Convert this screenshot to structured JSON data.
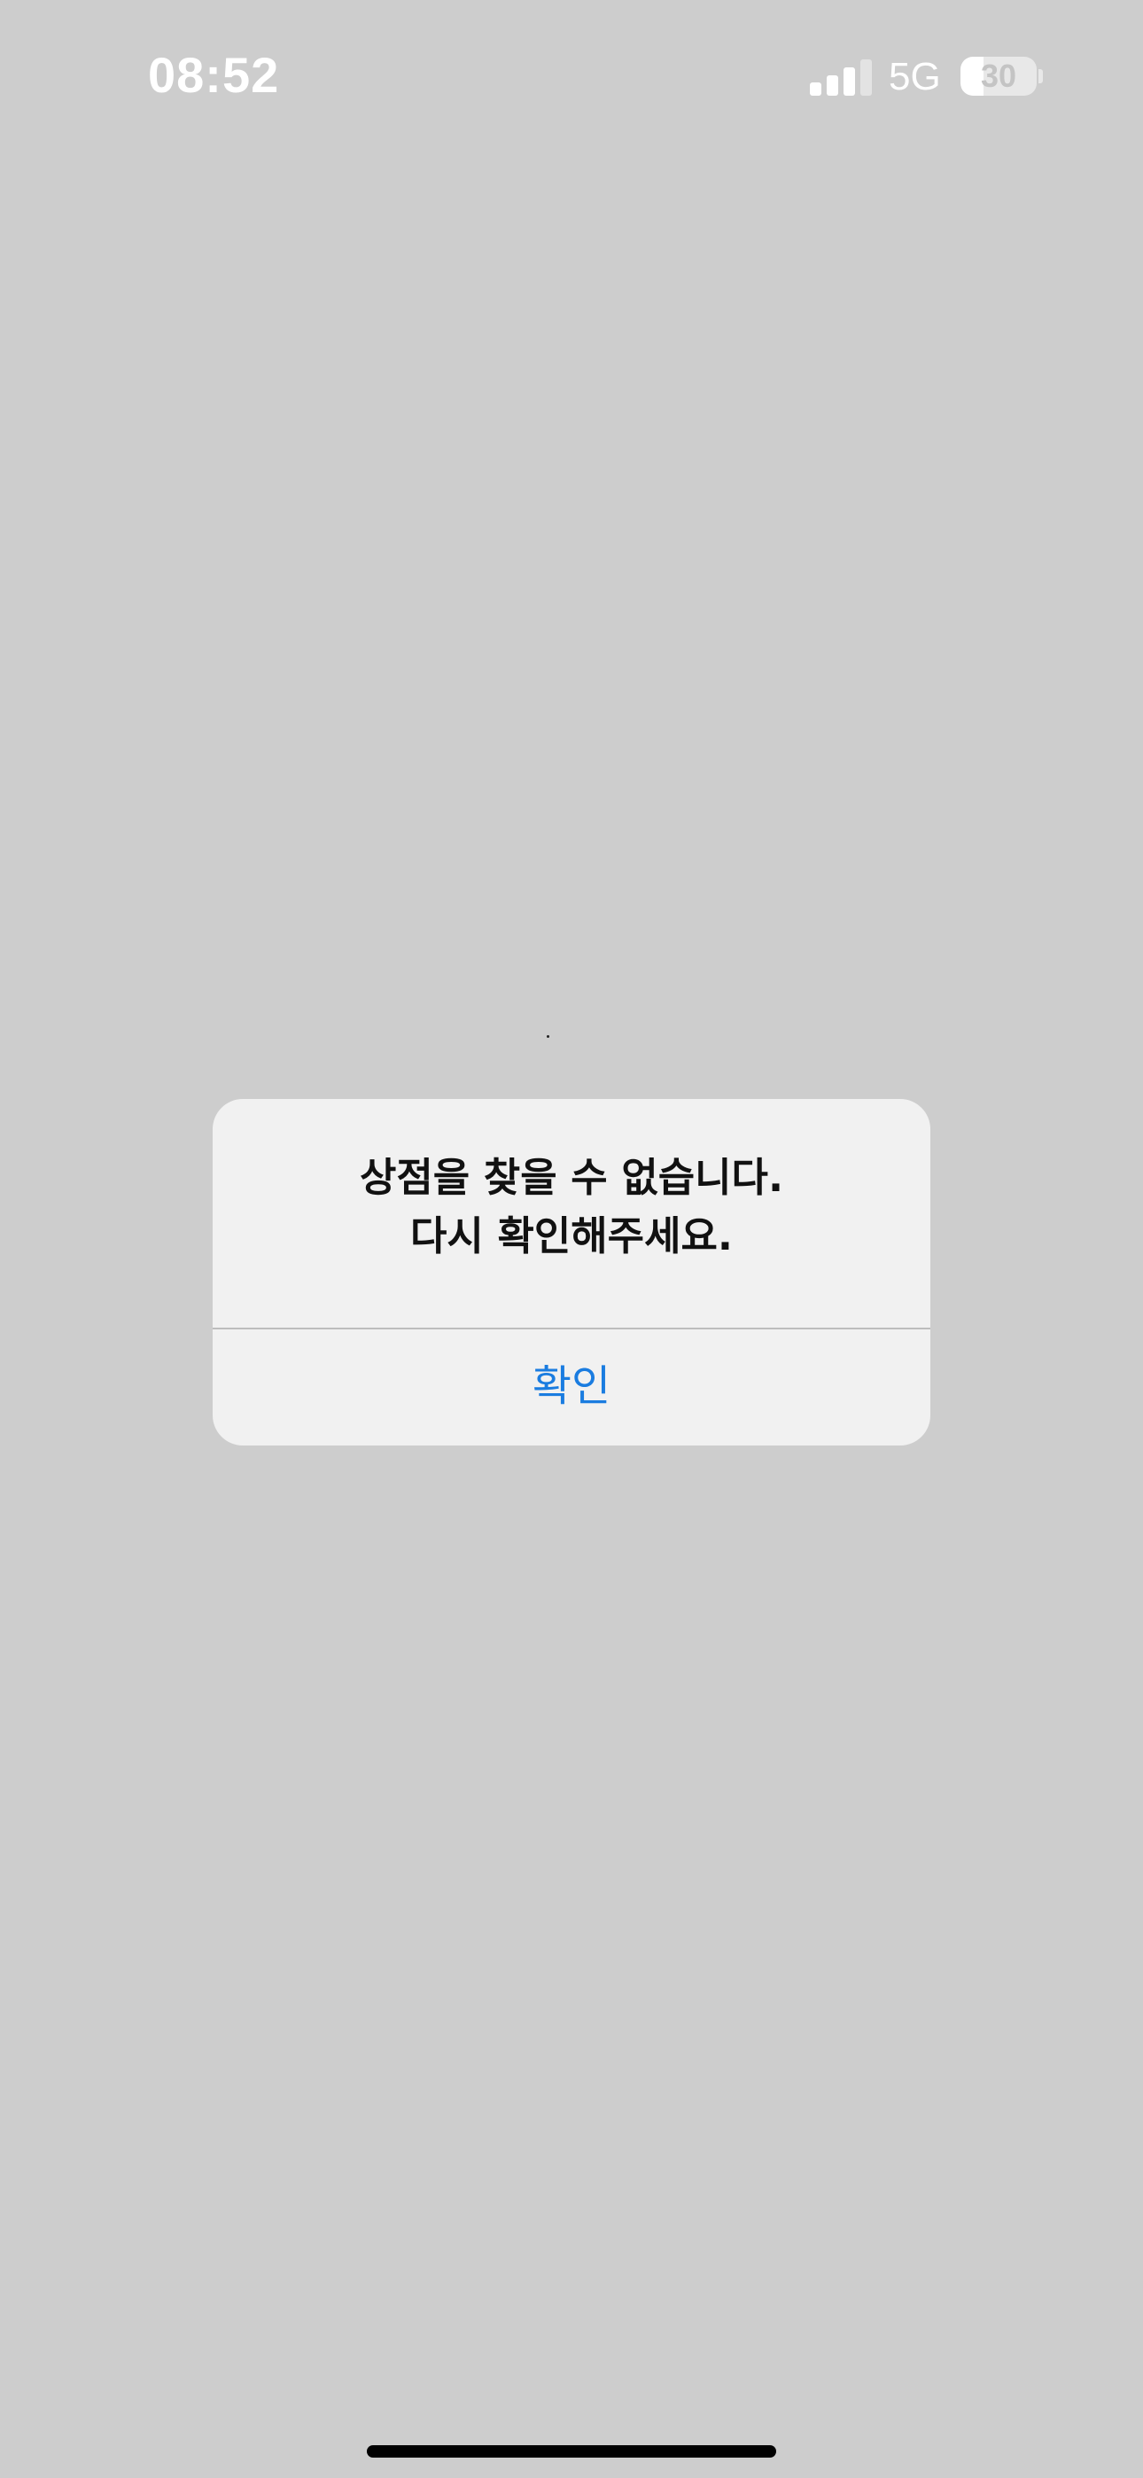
{
  "status_bar": {
    "time": "08:52",
    "network": "5G",
    "signal_bars_active": 3,
    "signal_bars_total": 4,
    "battery_level": "30",
    "battery_fraction": 0.3
  },
  "alert": {
    "message_line1": "상점을 찾을 수 없습니다.",
    "message_line2": "다시 확인해주세요.",
    "confirm_label": "확인"
  },
  "colors": {
    "background": "#cdcdcd",
    "alert_background": "#f1f1f1",
    "accent": "#1a7ce0"
  },
  "icons": {
    "signal": "cellular-signal-icon",
    "battery": "battery-icon"
  }
}
